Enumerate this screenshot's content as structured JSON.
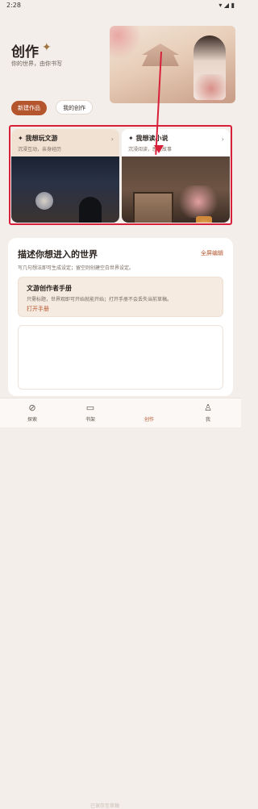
{
  "status": {
    "time": "2:28",
    "icons": "▾ ◢ ▮"
  },
  "header": {
    "title": "创作",
    "title_star": "✦",
    "subtitle": "你的世界，由你书写"
  },
  "tabs": [
    {
      "label": "新建作品",
      "active": true
    },
    {
      "label": "我的创作",
      "active": false
    }
  ],
  "cards": [
    {
      "title": "✦ 我想玩文游",
      "subtitle": "沉浸互动，亲身经历",
      "arrow": "›"
    },
    {
      "title": "✦ 我想读小说",
      "subtitle": "沉浸阅读，感受故事",
      "arrow": "›"
    }
  ],
  "panel": {
    "title": "描述你想进入的世界",
    "link": "全屏编辑",
    "hint": "写几句想法即可生成设定；留空则创建空白世界设定。",
    "manual": {
      "title": "文游创作者手册",
      "desc": "只需标题，世界观即可开始就能开始；打开手册不会丢失当前草稿。",
      "link": "打开手册"
    }
  },
  "bottom_nav": [
    {
      "label": "探索",
      "icon": "⊘",
      "active": false
    },
    {
      "label": "书架",
      "icon": "▭",
      "active": false
    },
    {
      "label": "创作",
      "icon": "doc",
      "active": true
    },
    {
      "label": "我",
      "icon": "♙",
      "active": false
    }
  ],
  "toast": "已保存至草稿"
}
